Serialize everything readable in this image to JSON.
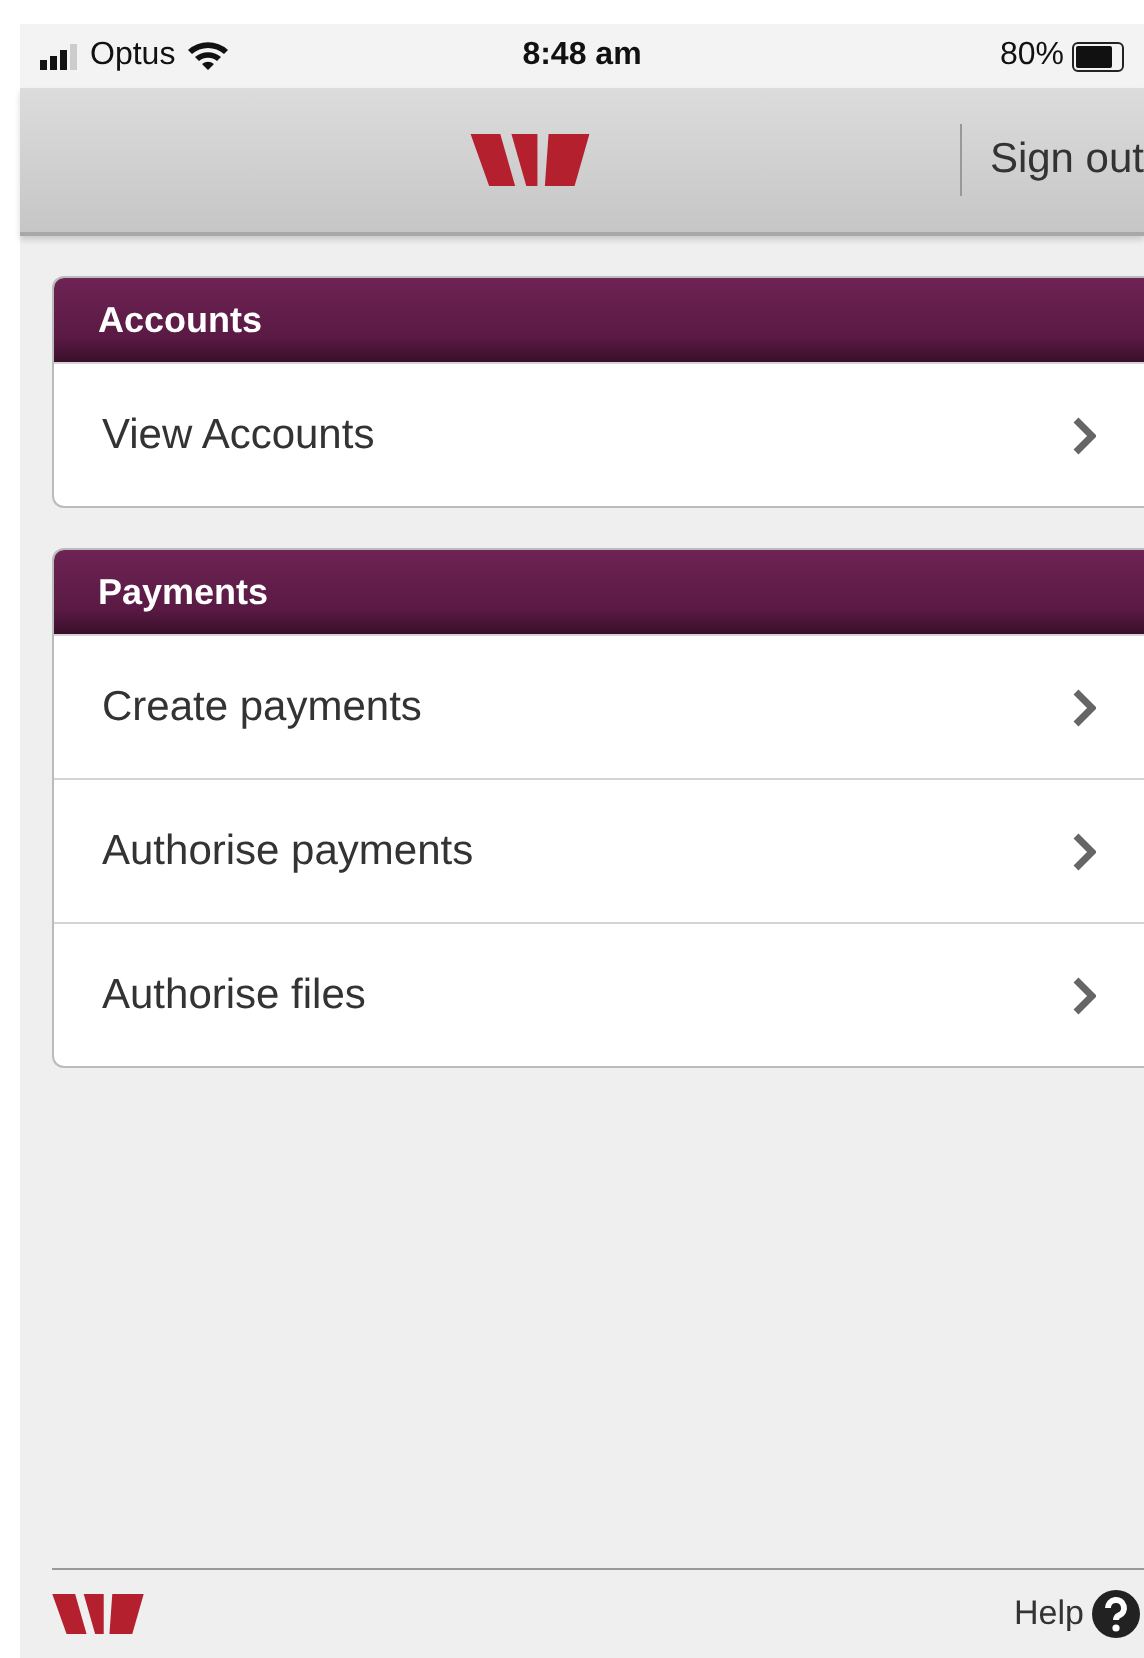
{
  "status_bar": {
    "carrier": "Optus",
    "time": "8:48 am",
    "battery": "80%"
  },
  "header": {
    "action": "Sign out"
  },
  "sections": [
    {
      "title": "Accounts",
      "items": [
        {
          "label": "View Accounts"
        }
      ]
    },
    {
      "title": "Payments",
      "items": [
        {
          "label": "Create payments"
        },
        {
          "label": "Authorise payments"
        },
        {
          "label": "Authorise files"
        }
      ]
    }
  ],
  "footer": {
    "help": "Help"
  }
}
